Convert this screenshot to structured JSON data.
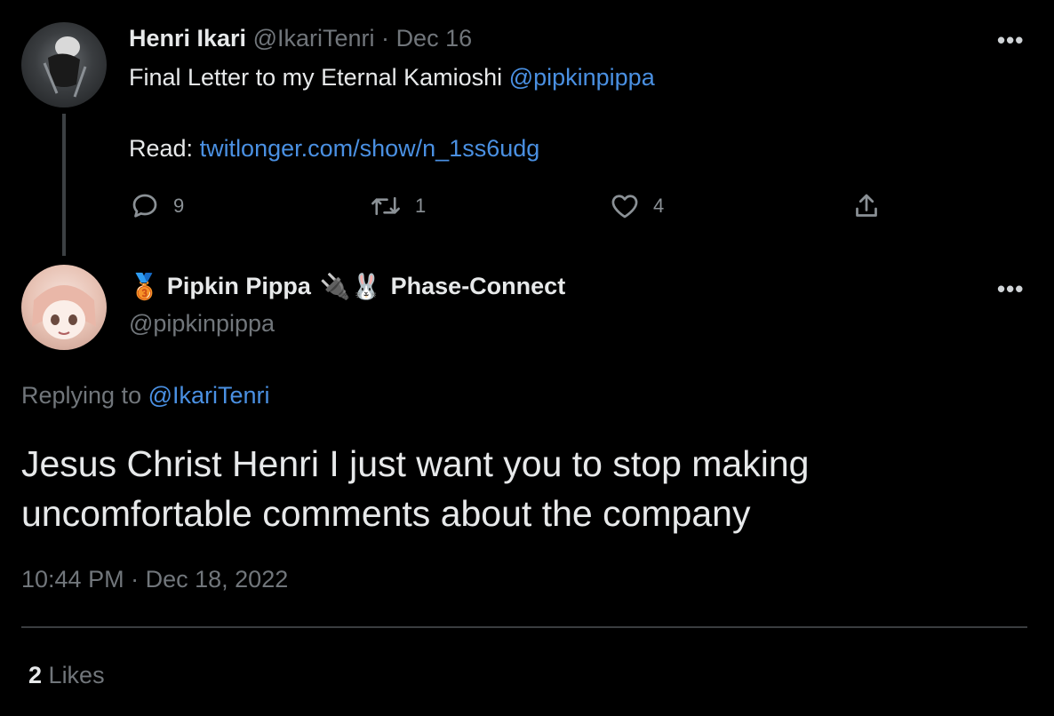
{
  "parent_tweet": {
    "display_name": "Henri Ikari",
    "handle": "@IkariTenri",
    "separator": "·",
    "date": "Dec 16",
    "text_line1": "Final Letter to my Eternal Kamioshi ",
    "mention": "@pipkinpippa",
    "read_label": "Read: ",
    "link": "twitlonger.com/show/n_1ss6udg",
    "more": "•••",
    "actions": {
      "reply_count": "9",
      "retweet_count": "1",
      "like_count": "4"
    }
  },
  "main_tweet": {
    "badge_emoji": "🥉",
    "display_name": "Pipkin Pippa",
    "name_emojis": "🔌🐰",
    "affiliation": "Phase-Connect",
    "handle": "@pipkinpippa",
    "more": "•••",
    "replying_label": "Replying to ",
    "replying_handle": "@IkariTenri",
    "body_line1": "Jesus Christ Henri I just want you to stop making",
    "body_line2": "uncomfortable comments about the company",
    "time": "10:44 PM",
    "separator": "·",
    "full_date": "Dec 18, 2022",
    "likes_count": "2",
    "likes_label": "Likes"
  },
  "colors": {
    "background": "#000000",
    "text": "#e7e9ea",
    "muted": "#71767b",
    "link": "#4a90e2"
  }
}
